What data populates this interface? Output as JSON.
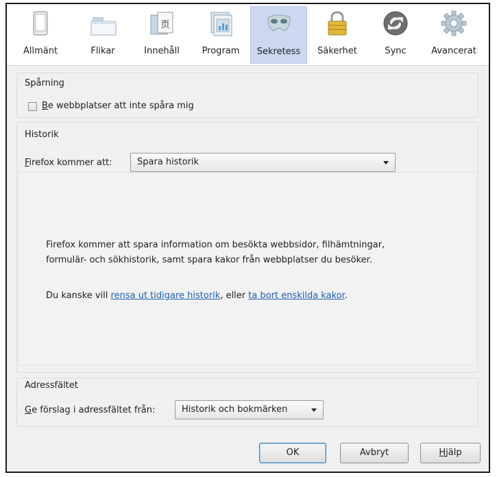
{
  "tabs": [
    {
      "id": "general",
      "label": "Allmänt",
      "icon": "general-icon",
      "selected": false
    },
    {
      "id": "tabs",
      "label": "Flikar",
      "icon": "tabs-icon",
      "selected": false
    },
    {
      "id": "content",
      "label": "Innehåll",
      "icon": "content-icon",
      "selected": false
    },
    {
      "id": "applications",
      "label": "Program",
      "icon": "applications-icon",
      "selected": false
    },
    {
      "id": "privacy",
      "label": "Sekretess",
      "icon": "mask-icon",
      "selected": true
    },
    {
      "id": "security",
      "label": "Säkerhet",
      "icon": "lock-icon",
      "selected": false
    },
    {
      "id": "sync",
      "label": "Sync",
      "icon": "sync-icon",
      "selected": false
    },
    {
      "id": "advanced",
      "label": "Avancerat",
      "icon": "gear-icon",
      "selected": false
    }
  ],
  "tracking": {
    "title": "Spårning",
    "dnt_label_key": "B",
    "dnt_label_rest": "e webbplatser att inte spåra mig",
    "dnt_checked": false
  },
  "history": {
    "title": "Historik",
    "mode_label_key": "F",
    "mode_label_rest": "irefox kommer att:",
    "mode_value": "Spara historik",
    "desc_line1": "Firefox kommer att spara information om besökta webbsidor, filhämtningar,",
    "desc_line2": "formulär- och sökhistorik, samt spara kakor från webbplatser du besöker.",
    "links_prefix": "Du kanske vill ",
    "link_clear": "rensa ut tidigare historik",
    "links_mid": ", eller ",
    "link_cookies": "ta bort enskilda kakor",
    "links_suffix": "."
  },
  "location_bar": {
    "title": "Adressfältet",
    "suggest_label_key": "G",
    "suggest_label_rest": "e förslag i adressfältet från:",
    "suggest_value": "Historik och bokmärken"
  },
  "buttons": {
    "ok": "OK",
    "cancel": "Avbryt",
    "help_key": "H",
    "help_rest": "jälp"
  }
}
